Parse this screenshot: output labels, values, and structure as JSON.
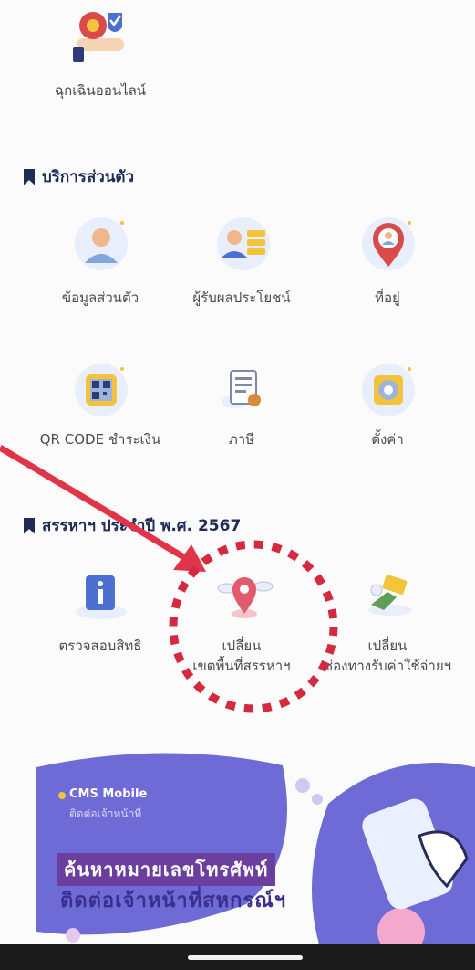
{
  "emergency": {
    "label": "ฉุกเฉินออนไลน์",
    "icon": "money-bag-shield-icon"
  },
  "personal": {
    "title": "บริการส่วนตัว",
    "items": [
      {
        "label": "ข้อมูลส่วนตัว",
        "icon": "person-profile-icon"
      },
      {
        "label": "ผู้รับผลประโยชน์",
        "icon": "beneficiary-list-icon"
      },
      {
        "label": "ที่อยู่",
        "icon": "location-person-icon"
      },
      {
        "label": "QR CODE ชำระเงิน",
        "icon": "qr-code-icon"
      },
      {
        "label": "ภาษี",
        "icon": "tax-document-icon"
      },
      {
        "label": "ตั้งค่า",
        "icon": "settings-icon"
      }
    ]
  },
  "welfare": {
    "title": "สรรหาฯ ประจำปี พ.ศ. 2567",
    "items": [
      {
        "label": "ตรวจสอบสิทธิ",
        "icon": "info-board-icon"
      },
      {
        "label_line1": "เปลี่ยน",
        "label_line2": "เขตพื้นที่สรรหาฯ",
        "icon": "map-pin-icon"
      },
      {
        "label_line1": "เปลี่ยน",
        "label_line2": "ช่องทางรับค่าใช้จ่ายฯ",
        "icon": "card-payment-icon"
      }
    ]
  },
  "banner": {
    "brand": "CMS Mobile",
    "brand_sub": "ติดต่อเจ้าหน้าที่",
    "headline": "ค้นหาหมายเลขโทรศัพท์",
    "subline": "ติดต่อเจ้าหน้าที่สหกรณ์ฯ"
  },
  "colors": {
    "accent": "#1f2a55",
    "arrow": "#e03448",
    "banner": "#6b3fa0"
  }
}
